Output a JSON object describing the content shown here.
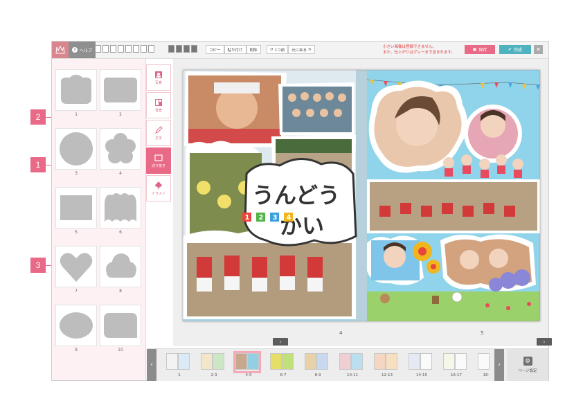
{
  "toolbar": {
    "help_label": "ヘルプ",
    "copy_label": "コピー",
    "paste_label": "貼り付け",
    "delete_label": "削除",
    "undo_label": "1つ前",
    "redo_label": "元に戻る",
    "notice_line1": "小さい画像は登録できません。",
    "notice_line2": "また、仕上がりはグレーまで含まれます。",
    "save_label": "保存",
    "done_label": "完成",
    "close_label": "×"
  },
  "shapes": {
    "labels": [
      "1",
      "2",
      "3",
      "4",
      "5",
      "6",
      "7",
      "8",
      "9",
      "10"
    ]
  },
  "side_tabs": [
    {
      "label": "写真"
    },
    {
      "label": "背景"
    },
    {
      "label": "文字"
    },
    {
      "label": "切り抜き"
    },
    {
      "label": "イラスト"
    }
  ],
  "spread": {
    "title_line1": "うんどう",
    "title_line2": "かい",
    "badges": [
      "1",
      "2",
      "3",
      "4"
    ],
    "left_page_number": "4",
    "right_page_number": "5",
    "prev_label": "‹",
    "next_label": "›"
  },
  "filmstrip": {
    "labels": [
      "1",
      "2-3",
      "4-5",
      "6-7",
      "8-9",
      "10-11",
      "12-13",
      "14-15",
      "16-17",
      "18-"
    ],
    "selected_index": 2,
    "page_settings_label": "ページ設定"
  },
  "callouts": [
    "2",
    "1",
    "3"
  ],
  "colors": {
    "accent_pink": "#e86a86",
    "done_teal": "#4fb2bf",
    "panel_bg": "#fdf1f3"
  }
}
